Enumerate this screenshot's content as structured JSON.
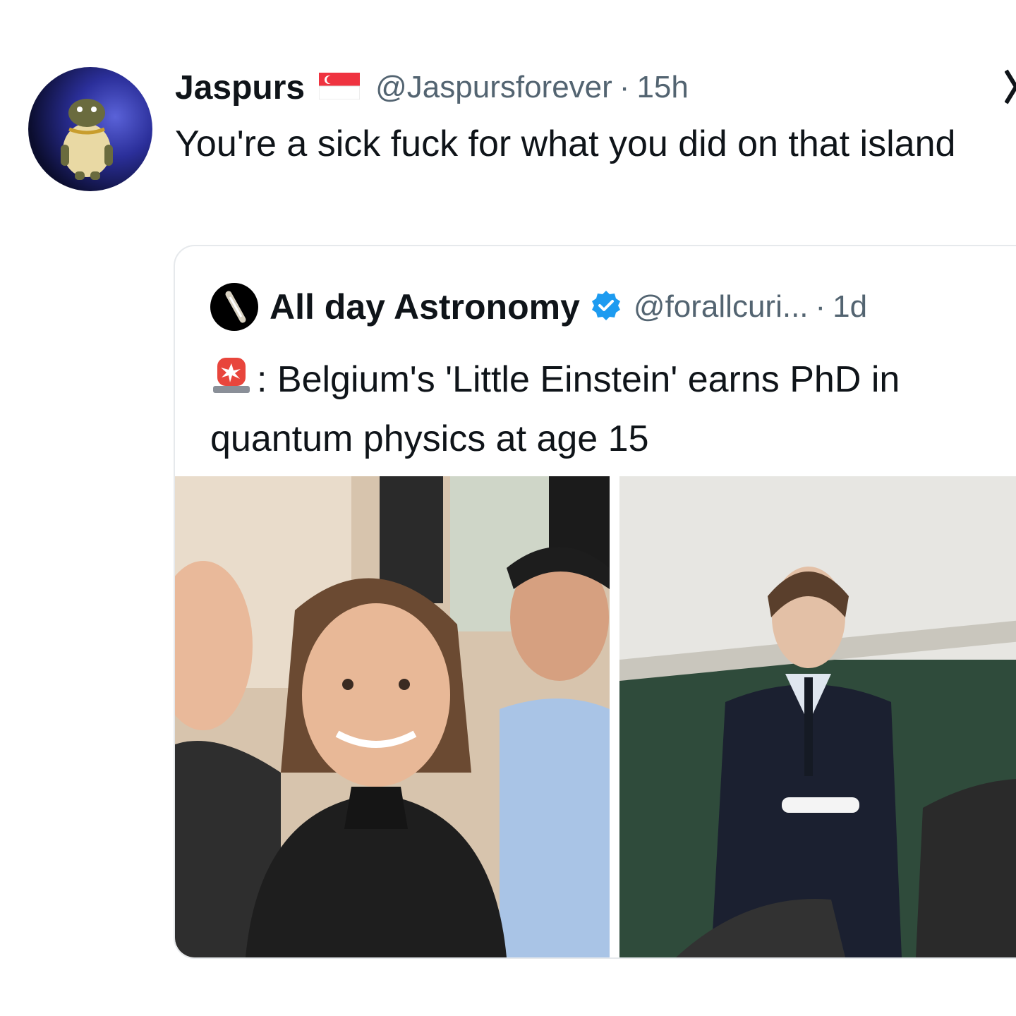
{
  "tweet": {
    "display_name": "Jaspurs",
    "handle": "@Jaspursforever",
    "separator": "·",
    "time": "15h",
    "flag_icon": "singapore-flag-icon",
    "text": "You're a sick fuck for what you did on that island"
  },
  "quoted_tweet": {
    "display_name": "All day Astronomy",
    "handle": "@forallcuri...",
    "separator": "·",
    "time": "1d",
    "verified_icon": "verified-badge-icon",
    "siren_icon": "police-light-emoji-icon",
    "text": ": Belgium's 'Little Einstein' earns PhD in quantum physics at age 15"
  },
  "colors": {
    "text_primary": "#0f1419",
    "text_secondary": "#536471",
    "verified_blue": "#1d9bf0",
    "border": "#e6e9ec"
  }
}
